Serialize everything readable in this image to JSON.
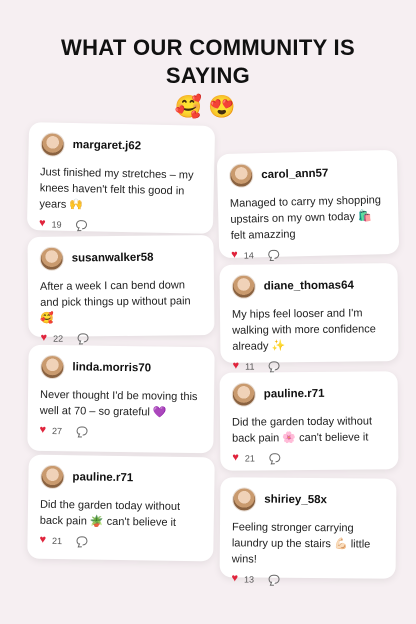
{
  "heading": {
    "line1": "WHAT OUR COMMUNITY IS",
    "line2": "SAYING",
    "emojis": "🥰😍"
  },
  "reviews": [
    {
      "username": "margaret.j62",
      "text": "Just finished my stretches – my knees haven't felt this good in years 🙌",
      "likes": "19"
    },
    {
      "username": "carol_ann57",
      "text": "Managed to carry my shopping upstairs on my own today 🛍️ felt amazzing",
      "likes": "14"
    },
    {
      "username": "susanwalker58",
      "text": "After a week I can bend down and pick things up without pain 🥰",
      "likes": "22"
    },
    {
      "username": "diane_thomas64",
      "text": "My hips feel looser and I'm walking with more confidence already ✨",
      "likes": "11"
    },
    {
      "username": "linda.morris70",
      "text": "Never thought I'd be moving this well at 70 – so grateful 💜",
      "likes": "27"
    },
    {
      "username": "pauline.r71",
      "text": "Did the garden today without back pain 🌸 can't believe it",
      "likes": "21"
    },
    {
      "username": "pauline.r71",
      "text": "Did the garden today without back pain 🪴 can't believe it",
      "likes": "21"
    },
    {
      "username": "shiriey_58x",
      "text": "Feeling stronger carrying laundry up the stairs 💪🏻 little wins!",
      "likes": "13"
    }
  ]
}
